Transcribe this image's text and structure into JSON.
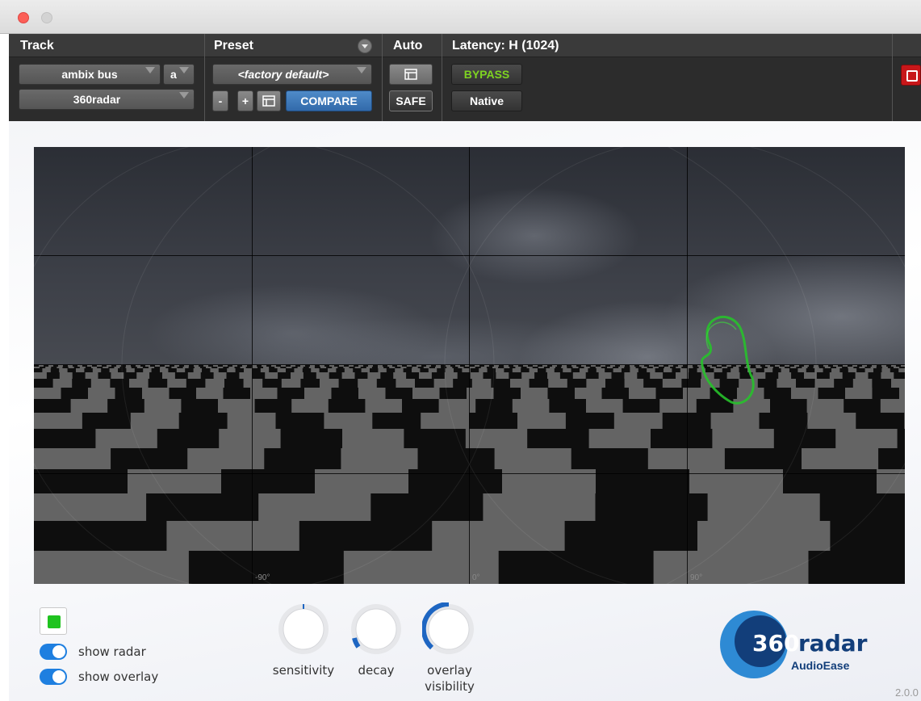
{
  "window": {
    "close_color": "#fc5f57",
    "minimize_color": "#d3d3d3"
  },
  "header": {
    "track_label": "Track",
    "preset_label": "Preset",
    "auto_label": "Auto",
    "latency_label": "Latency: H (1024)",
    "track_name": "ambix bus",
    "track_channel": "a",
    "insert_name": "360radar",
    "preset_name": "<factory default>",
    "preset_minus": "-",
    "preset_plus": "+",
    "compare_label": "COMPARE",
    "safe_label": "SAFE",
    "bypass_label": "BYPASS",
    "native_label": "Native",
    "bypass_color": "#7ed321",
    "compare_color": "#3a75b8"
  },
  "panorama": {
    "degree_labels": [
      "-90°",
      "0°",
      "90°"
    ],
    "radar_color": "#27c12b"
  },
  "controls": {
    "swatch_color": "#1fc31f",
    "show_radar_label": "show radar",
    "show_radar_on": true,
    "show_overlay_label": "show overlay",
    "show_overlay_on": true,
    "sensitivity_label": "sensitivity",
    "decay_label": "decay",
    "overlay_visibility_label": "overlay visibility",
    "knobs": {
      "sensitivity": 0.5,
      "decay": 0.12,
      "overlay_visibility": 0.4
    },
    "knob_accent": "#1e66c2"
  },
  "brand": {
    "logo_text_360": "360",
    "logo_text_radar": "radar",
    "logo_sub": "AudioEase",
    "version": "2.0.0"
  }
}
